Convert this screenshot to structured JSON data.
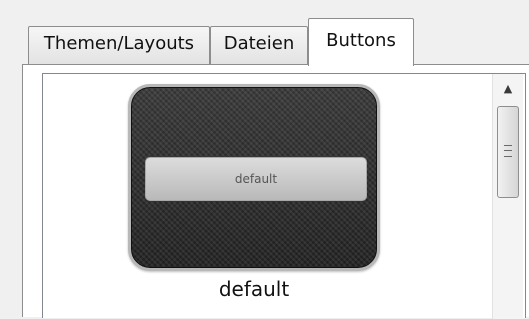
{
  "tabs": [
    {
      "label": "Themen/Layouts",
      "active": false
    },
    {
      "label": "Dateien",
      "active": false
    },
    {
      "label": "Buttons",
      "active": true
    }
  ],
  "button_list": {
    "items": [
      {
        "preview_text": "default",
        "label": "default"
      }
    ]
  },
  "scrollbar": {
    "up_arrow": "▲"
  }
}
